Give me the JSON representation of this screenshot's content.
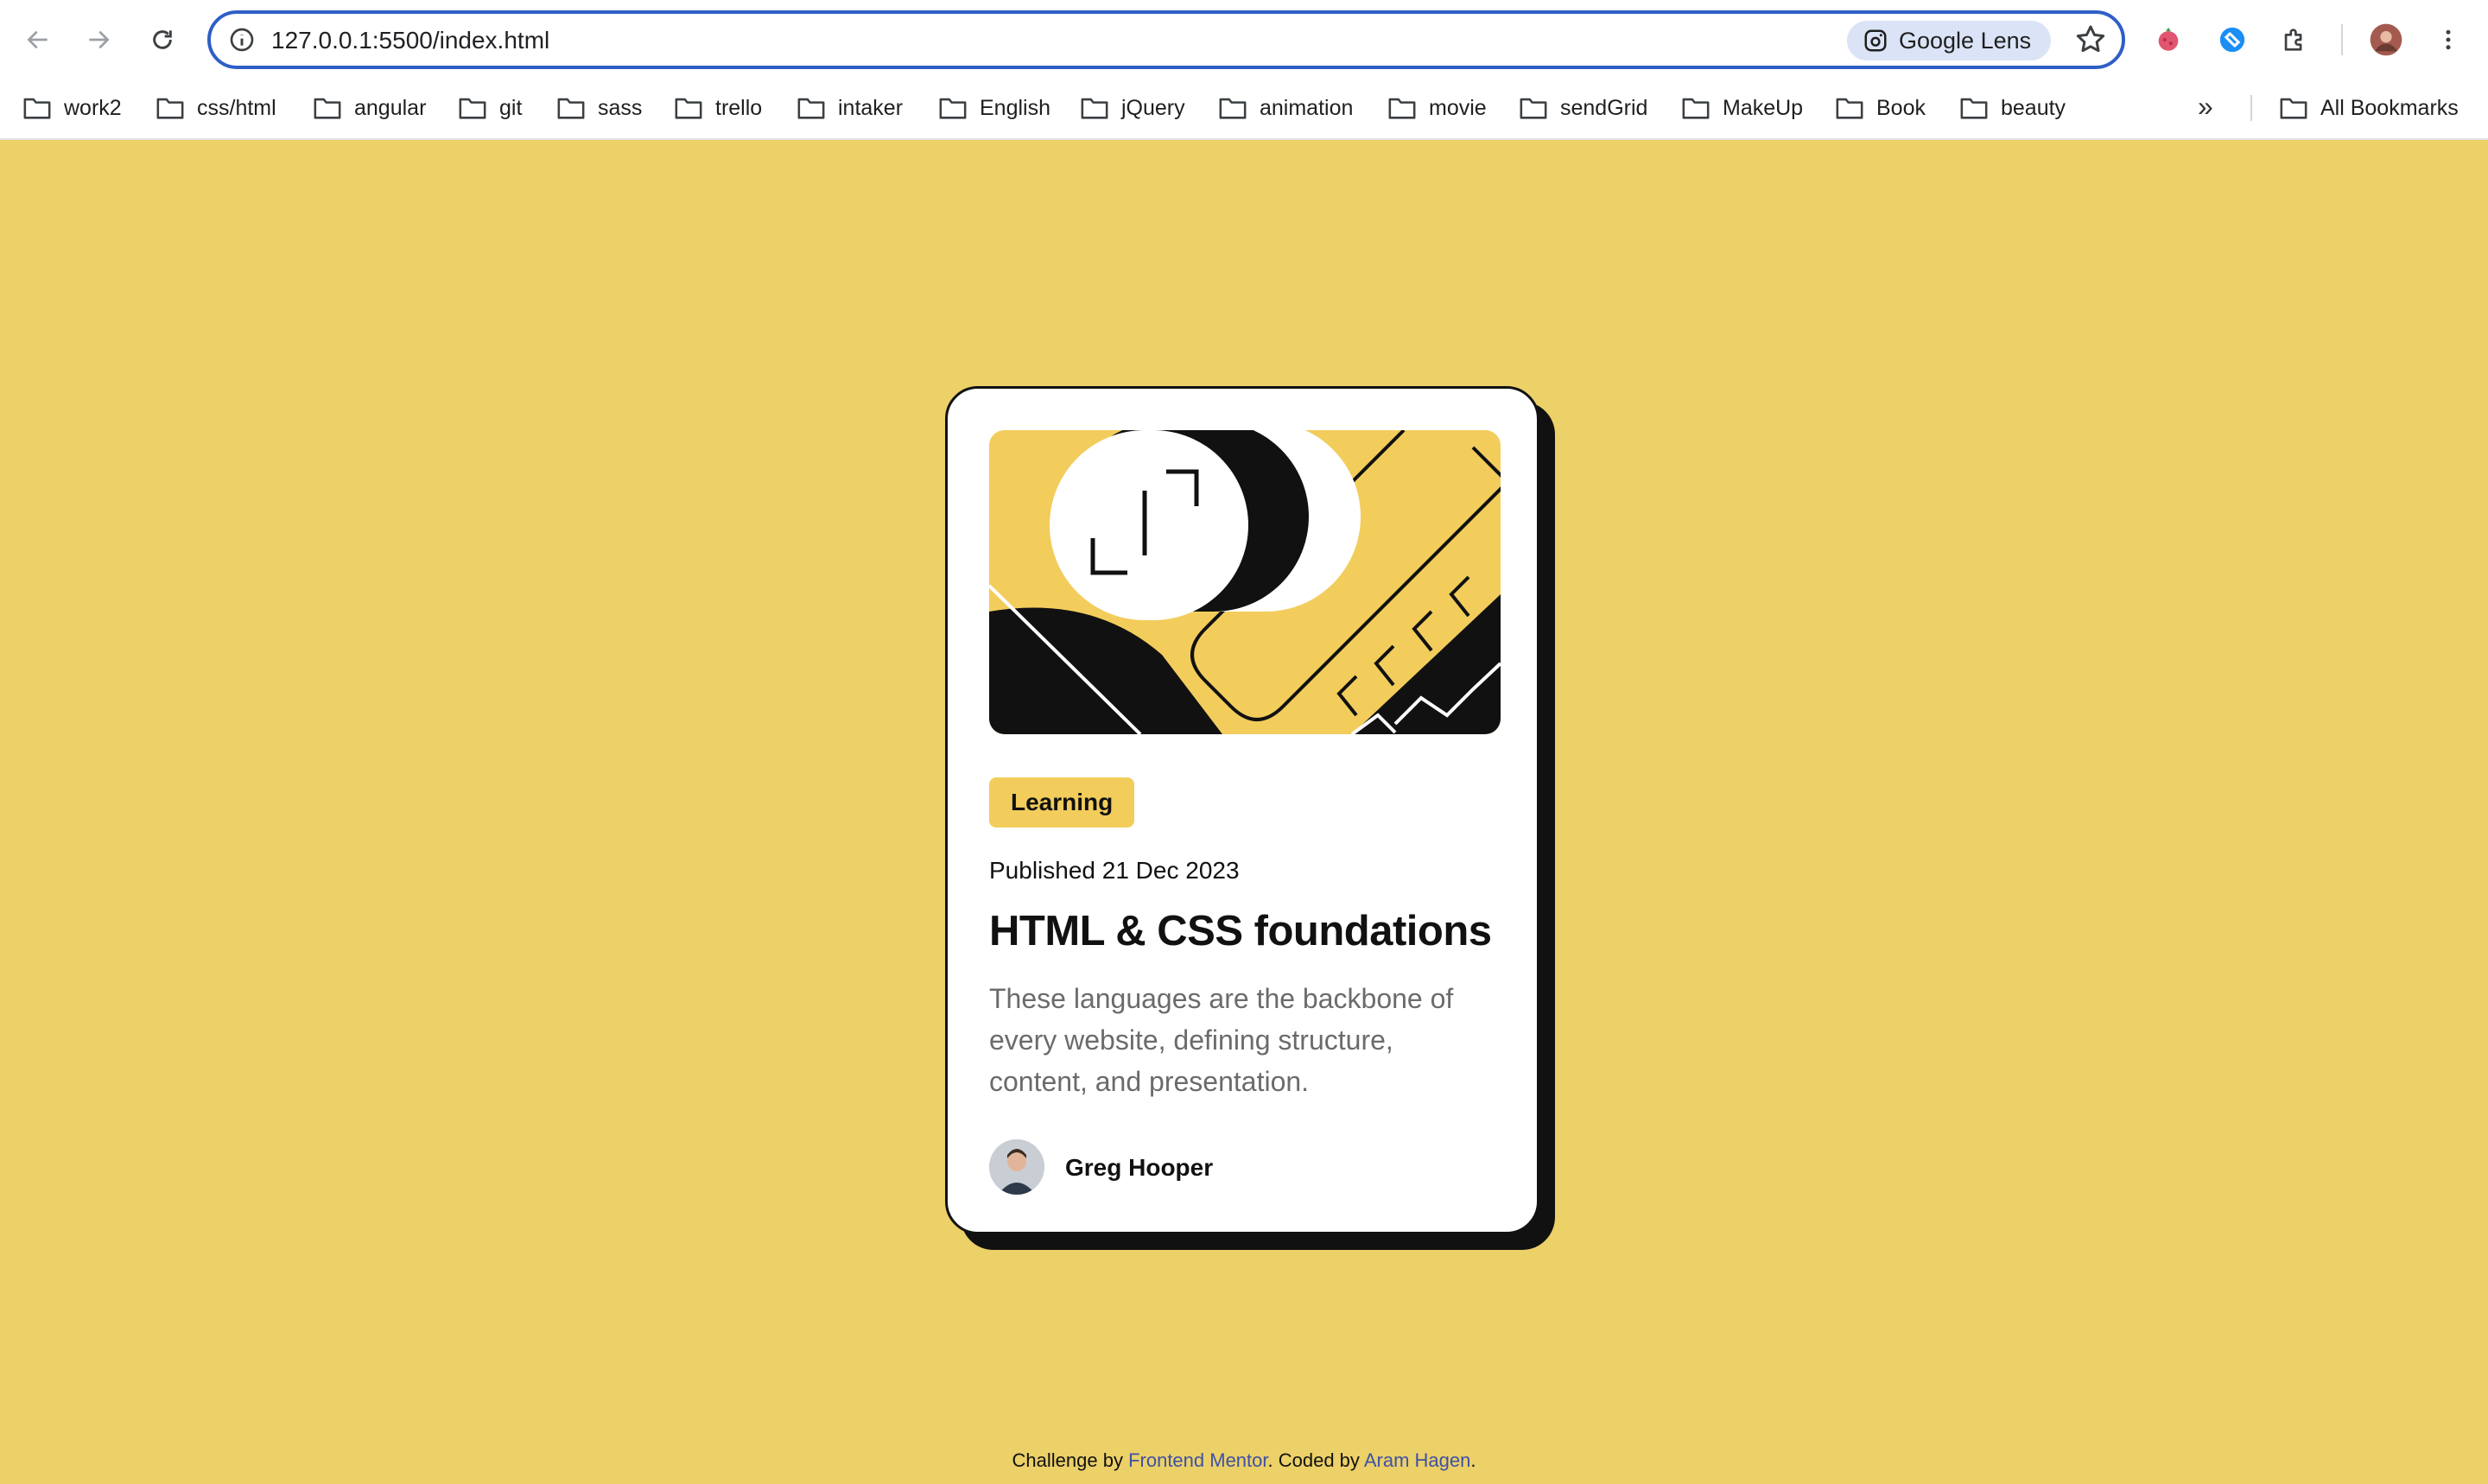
{
  "browser": {
    "url": "127.0.0.1:5500/index.html",
    "lens_label": "Google Lens",
    "bookmarks": [
      {
        "label": "work2"
      },
      {
        "label": "css/html"
      },
      {
        "label": "angular"
      },
      {
        "label": "git"
      },
      {
        "label": "sass"
      },
      {
        "label": "trello"
      },
      {
        "label": "intaker"
      },
      {
        "label": "English"
      },
      {
        "label": "jQuery"
      },
      {
        "label": "animation"
      },
      {
        "label": "movie"
      },
      {
        "label": "sendGrid"
      },
      {
        "label": "MakeUp"
      },
      {
        "label": "Book"
      },
      {
        "label": "beauty"
      }
    ],
    "bookmarks_more": "»",
    "all_bookmarks_label": "All Bookmarks"
  },
  "card": {
    "tag": "Learning",
    "published": "Published 21 Dec 2023",
    "title": "HTML & CSS foundations",
    "description": "These languages are the backbone of every website, defining structure, content, and presentation.",
    "author": "Greg Hooper"
  },
  "footer": {
    "prefix": "Challenge by ",
    "link1": "Frontend Mentor",
    "middle": ". Coded by ",
    "link2": "Aram Hagen",
    "suffix": "."
  },
  "colors": {
    "page_background": "#ecd068",
    "accent_yellow": "#f2cd5c",
    "card_border": "#111111",
    "omnibox_border": "#2f5fc6",
    "footer_link": "#3e52a3"
  }
}
